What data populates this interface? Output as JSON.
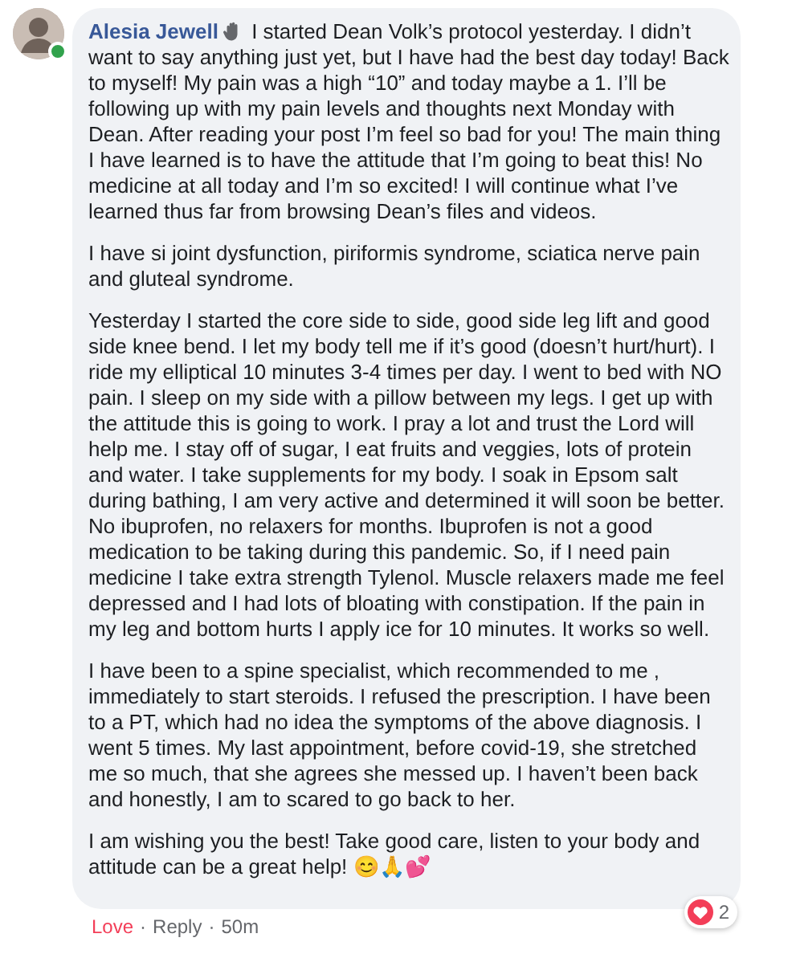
{
  "comment": {
    "author": "Alesia Jewell",
    "online": true,
    "paragraphs": [
      "I started Dean Volk’s protocol yesterday. I didn’t want to say anything just yet, but I have had the best day today! Back to myself! My pain was a high “10” and today maybe a 1. I’ll be following up with my pain levels and thoughts next Monday with Dean. After reading your post I’m feel so bad for you! The main thing I have learned is to have the attitude that I’m going to beat this! No medicine at all today and I’m so excited! I will continue what I’ve learned thus far from browsing Dean’s files and videos.",
      "I have si joint dysfunction, piriformis syndrome, sciatica nerve pain and gluteal syndrome.",
      "Yesterday I started the core side to side, good side leg lift and good side knee bend. I let my body tell me if it’s good (doesn’t hurt/hurt). I ride my elliptical 10 minutes 3-4 times per day. I went to bed with NO pain. I sleep on my side with a pillow between my legs. I get up with the attitude this is going to work. I pray a lot and trust the Lord will help me. I stay off of sugar, I eat fruits and veggies, lots of protein and water. I take supplements for my body. I soak in Epsom salt during bathing, I am very active and determined it will soon be better. No ibuprofen, no relaxers for months. Ibuprofen is not a good medication to be taking during this pandemic. So, if I need pain medicine I take extra strength Tylenol. Muscle relaxers made me feel depressed and I had lots of bloating with constipation. If the pain in my leg and bottom hurts I apply ice for 10 minutes. It works so well.",
      "I have been to a spine specialist, which recommended to me , immediately to start steroids. I refused the prescription. I have been to a PT, which had no idea the symptoms of the above diagnosis. I went 5 times. My last appointment, before covid-19, she stretched me so much, that she agrees she messed up. I haven’t been back and honestly, I am to scared to go back to her.",
      "I am wishing you the best! Take good care, listen to your body and attitude can be a great help! 😊🙏💕"
    ],
    "actions": [
      {
        "label": "Love",
        "active": true,
        "separator": "·"
      },
      {
        "label": "Reply",
        "active": false,
        "separator": "·"
      }
    ],
    "time": "50m",
    "reaction_count": "2"
  }
}
